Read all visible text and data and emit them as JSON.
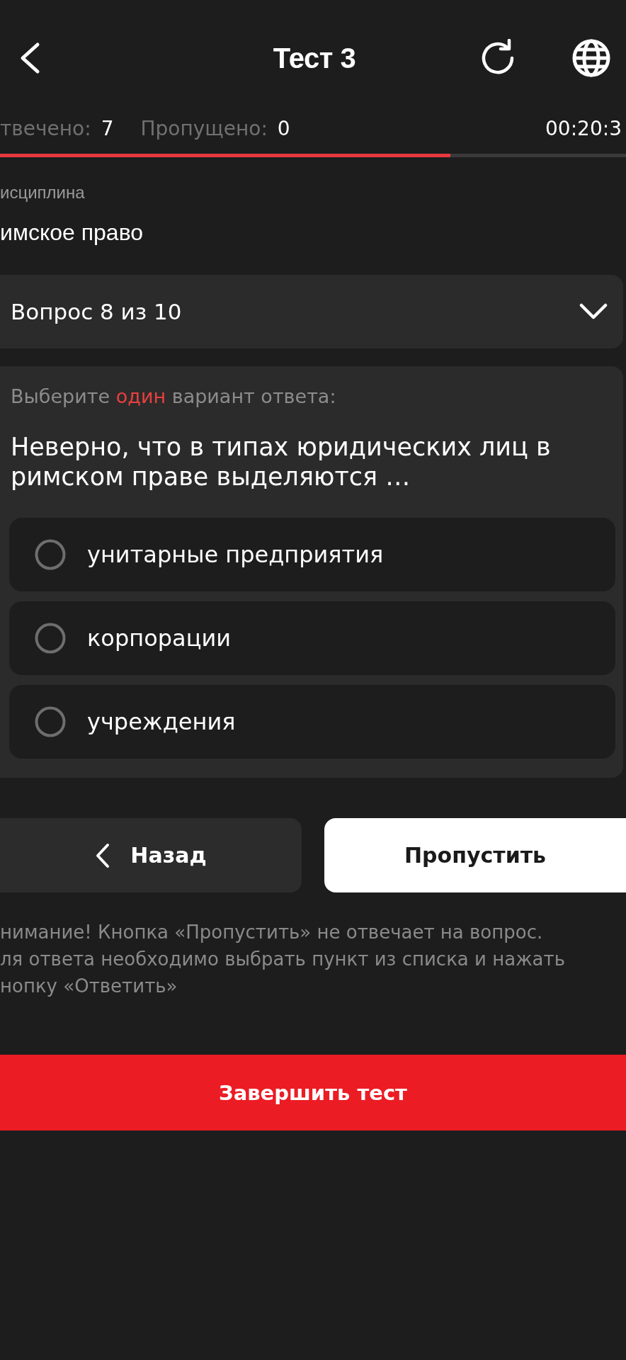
{
  "header": {
    "title": "Тест 3"
  },
  "stats": [
    {
      "label": "твечено:",
      "value": "7"
    },
    {
      "label": "Пропущено:",
      "value": "0"
    }
  ],
  "timer": "00:20:3",
  "progress": {
    "level": 0.72
  },
  "discipline": {
    "label": "исциплина",
    "value": "имское право"
  },
  "question_select": {
    "label": "Вопрос 8 из 10",
    "expanded": false
  },
  "question": {
    "instruction": {
      "before": "Выберите",
      "emphasis": "один",
      "after": "вариант ответа:"
    },
    "text": "Неверно, что в типах юридических лиц в римском праве выделяются …",
    "options": [
      {
        "text": "унитарные предприятия",
        "selected": false
      },
      {
        "text": "корпорации",
        "selected": false
      },
      {
        "text": "учреждения",
        "selected": false
      }
    ]
  },
  "buttons": [
    {
      "kind": "back",
      "label": "Назад"
    },
    {
      "kind": "skip",
      "label": "Пропустить"
    }
  ],
  "notice": {
    "lines": [
      "нимание! Кнопка «Пропустить» не отвечает на вопрос.",
      "ля ответа необходимо выбрать пункт из списка и нажать",
      "нопку «Ответить»"
    ]
  },
  "finish_button": {
    "label": "Завершить тест"
  }
}
